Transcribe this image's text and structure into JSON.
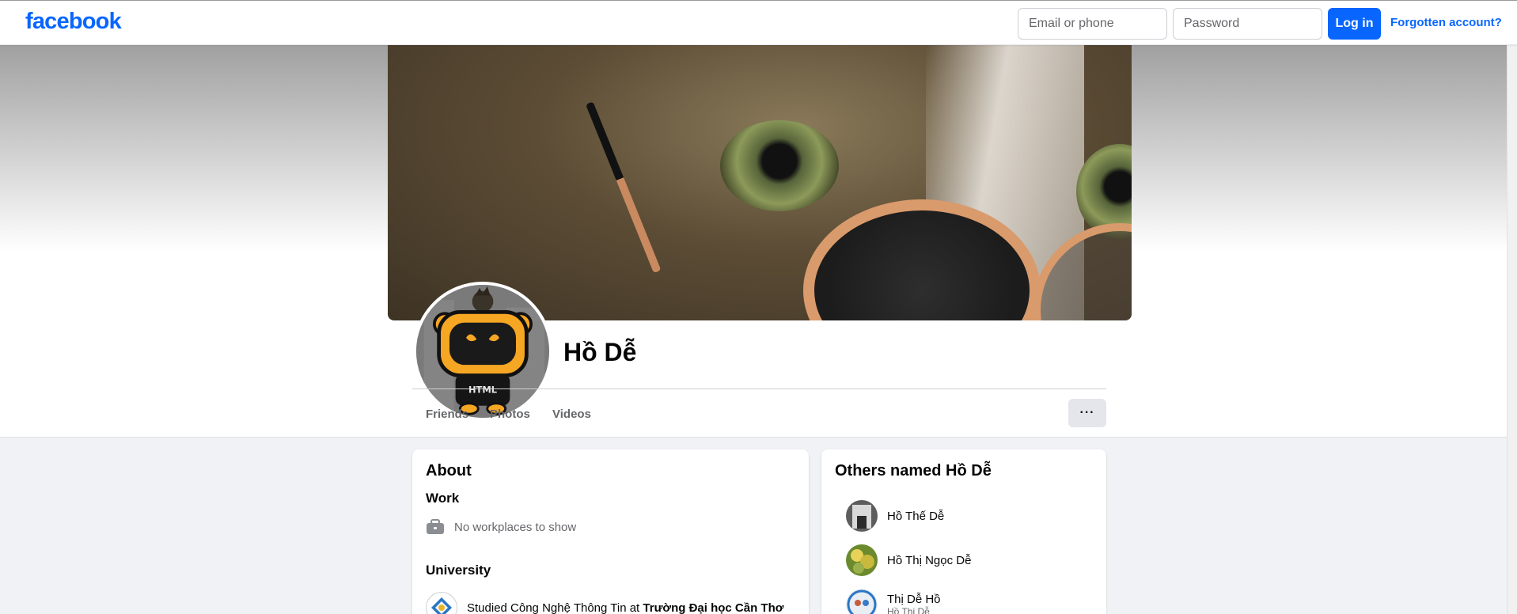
{
  "header": {
    "logo": "facebook",
    "email_placeholder": "Email or phone",
    "password_placeholder": "Password",
    "login_label": "Log in",
    "forgot_label": "Forgotten account?"
  },
  "profile": {
    "name": "Hồ Dễ",
    "avatar_badge_text": "HTML",
    "tabs": [
      "Friends",
      "Photos",
      "Videos"
    ],
    "more_label": "···"
  },
  "about": {
    "title": "About",
    "work_title": "Work",
    "work_empty": "No workplaces to show",
    "university_title": "University",
    "studied_prefix": "Studied Công Nghệ Thông Tin at",
    "school_name": "Trường Đại học Cần Thơ"
  },
  "others": {
    "title": "Others named Hồ Dễ",
    "people": [
      {
        "name": "Hồ Thế Dễ",
        "subtitle": ""
      },
      {
        "name": "Hồ Thị Ngọc Dễ",
        "subtitle": ""
      },
      {
        "name": "Thị Dễ Hồ",
        "subtitle": "Hồ Thị Dễ"
      }
    ]
  },
  "colors": {
    "brand_blue": "#0866ff",
    "page_background": "#f0f2f5",
    "muted_text": "#65676b"
  },
  "icons": [
    "briefcase-icon",
    "university-logo-icon",
    "more-icon"
  ]
}
